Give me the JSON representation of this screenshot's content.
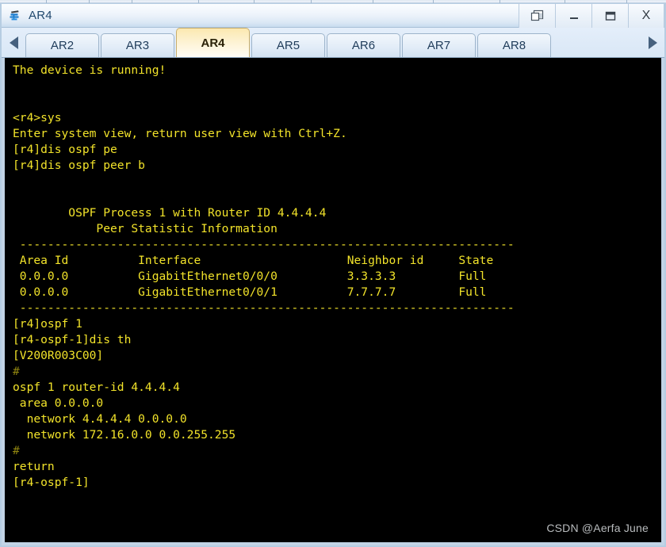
{
  "window": {
    "title": "AR4",
    "app_icon": "router-icon",
    "controls": [
      {
        "name": "restore-window-button",
        "glyph": "❐",
        "label": "Restore"
      },
      {
        "name": "minimize-button",
        "glyph": "–",
        "label": "Minimize"
      },
      {
        "name": "maximize-button",
        "glyph": "❐",
        "label": "Maximize"
      },
      {
        "name": "close-button",
        "glyph": "X",
        "label": "Close"
      }
    ]
  },
  "tabbar": {
    "scroll_left_icon": "chevron-left-icon",
    "scroll_right_icon": "chevron-right-icon",
    "active_tab": "AR4",
    "tabs": [
      {
        "label": "AR2"
      },
      {
        "label": "AR3"
      },
      {
        "label": "AR4"
      },
      {
        "label": "AR5"
      },
      {
        "label": "AR6"
      },
      {
        "label": "AR7"
      },
      {
        "label": "AR8"
      }
    ]
  },
  "terminal": {
    "fg_color": "#f2e32a",
    "dim_color": "#8f8410",
    "bg_color": "#000000",
    "lines": [
      {
        "text": "The device is running!",
        "style": "normal"
      },
      {
        "text": "",
        "style": "blank"
      },
      {
        "text": "",
        "style": "blank"
      },
      {
        "text": "<r4>sys",
        "style": "normal"
      },
      {
        "text": "Enter system view, return user view with Ctrl+Z.",
        "style": "normal"
      },
      {
        "text": "[r4]dis ospf pe",
        "style": "normal"
      },
      {
        "text": "[r4]dis ospf peer b",
        "style": "normal"
      },
      {
        "text": "",
        "style": "blank"
      },
      {
        "text": "",
        "style": "blank"
      },
      {
        "text": "        OSPF Process 1 with Router ID 4.4.4.4",
        "style": "normal"
      },
      {
        "text": "            Peer Statistic Information",
        "style": "normal"
      },
      {
        "text": " -----------------------------------------------------------------------",
        "style": "normal"
      },
      {
        "text": " Area Id          Interface                     Neighbor id     State",
        "style": "normal"
      },
      {
        "text": " 0.0.0.0          GigabitEthernet0/0/0          3.3.3.3         Full",
        "style": "normal"
      },
      {
        "text": " 0.0.0.0          GigabitEthernet0/0/1          7.7.7.7         Full",
        "style": "normal"
      },
      {
        "text": " -----------------------------------------------------------------------",
        "style": "normal"
      },
      {
        "text": "[r4]ospf 1",
        "style": "normal"
      },
      {
        "text": "[r4-ospf-1]dis th",
        "style": "normal"
      },
      {
        "text": "[V200R003C00]",
        "style": "normal"
      },
      {
        "text": "#",
        "style": "dim"
      },
      {
        "text": "ospf 1 router-id 4.4.4.4",
        "style": "normal"
      },
      {
        "text": " area 0.0.0.0",
        "style": "normal"
      },
      {
        "text": "  network 4.4.4.4 0.0.0.0",
        "style": "normal"
      },
      {
        "text": "  network 172.16.0.0 0.0.255.255",
        "style": "normal"
      },
      {
        "text": "#",
        "style": "dim"
      },
      {
        "text": "return",
        "style": "normal"
      },
      {
        "text": "[r4-ospf-1]",
        "style": "normal"
      }
    ]
  },
  "watermark": {
    "text": "CSDN @Aerfa June"
  },
  "ospf_table": {
    "process": "OSPF Process 1 with Router ID 4.4.4.4",
    "subtitle": "Peer Statistic Information",
    "columns": [
      "Area Id",
      "Interface",
      "Neighbor id",
      "State"
    ],
    "rows": [
      [
        "0.0.0.0",
        "GigabitEthernet0/0/0",
        "3.3.3.3",
        "Full"
      ],
      [
        "0.0.0.0",
        "GigabitEthernet0/0/1",
        "7.7.7.7",
        "Full"
      ]
    ]
  }
}
